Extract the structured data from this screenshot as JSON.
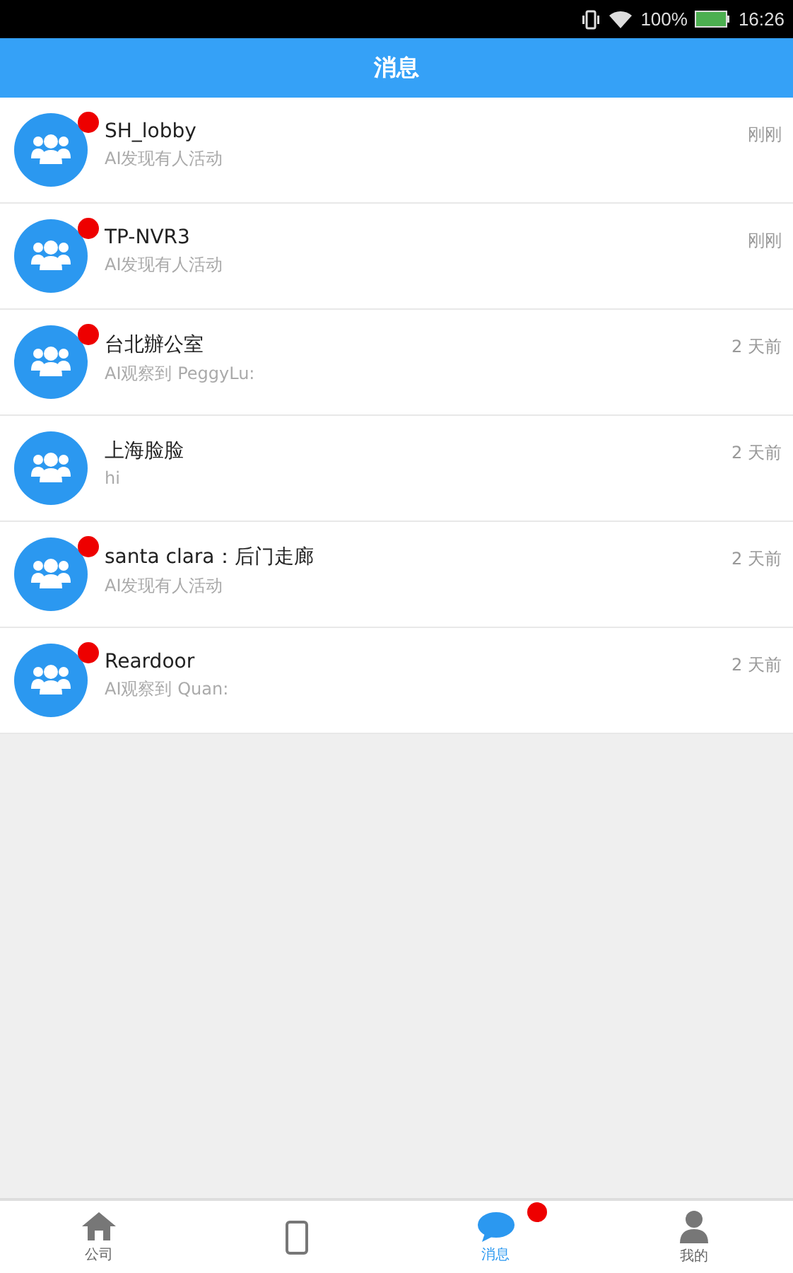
{
  "status_bar": {
    "battery": "100%",
    "time": "16:26"
  },
  "header": {
    "title": "消息"
  },
  "messages": [
    {
      "name": "SH_lobby",
      "preview": "AI发现有人活动",
      "time": "刚刚",
      "unread": true
    },
    {
      "name": "TP-NVR3",
      "preview": "AI发现有人活动",
      "time": "刚刚",
      "unread": true
    },
    {
      "name": "台北辦公室",
      "preview": "AI观察到 PeggyLu:",
      "time": "2 天前",
      "unread": true
    },
    {
      "name": "上海脸脸",
      "preview": "hi",
      "time": "2 天前",
      "unread": false
    },
    {
      "name": "santa clara：后门走廊",
      "preview": "AI发现有人活动",
      "time": "2 天前",
      "unread": true
    },
    {
      "name": "Reardoor",
      "preview": "AI观察到 Quan:",
      "time": "2 天前",
      "unread": true
    }
  ],
  "tab_bar": [
    {
      "kind": "home",
      "label": "公司",
      "selected": false,
      "badge": false
    },
    {
      "kind": "phone",
      "selected": false,
      "badge": false
    },
    {
      "kind": "chat",
      "label": "消息",
      "selected": true,
      "badge": true
    },
    {
      "kind": "person",
      "label": "我的",
      "selected": false,
      "badge": false
    }
  ]
}
